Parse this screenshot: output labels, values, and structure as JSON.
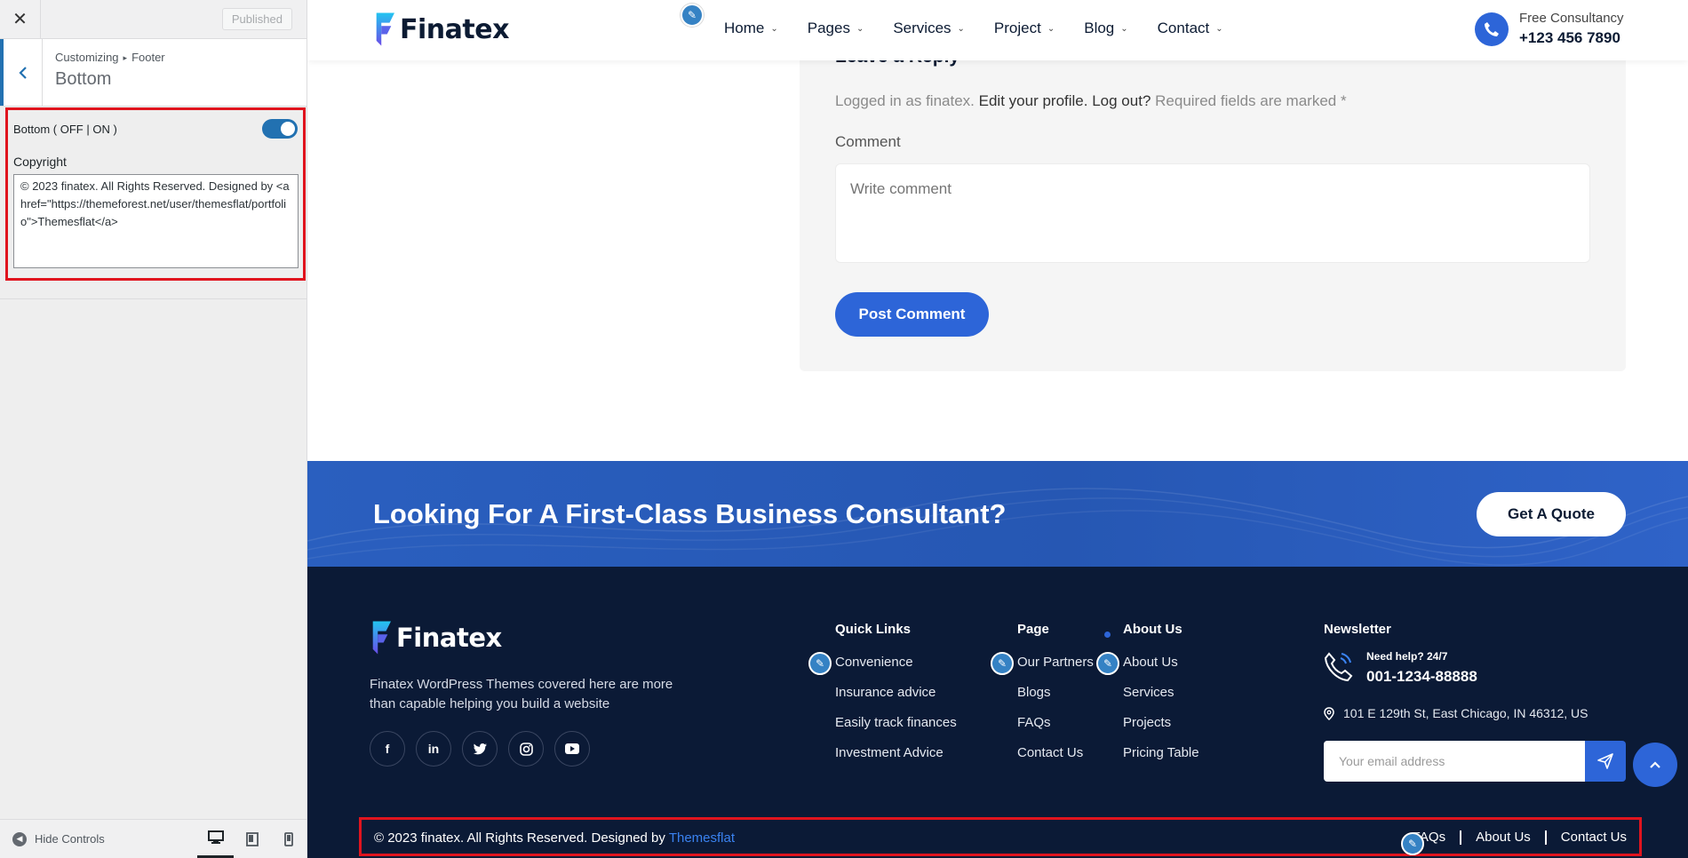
{
  "customizer": {
    "close_glyph": "✕",
    "published_label": "Published",
    "breadcrumb_root": "Customizing",
    "breadcrumb_sep": "▸",
    "breadcrumb_parent": "Footer",
    "section_title": "Bottom",
    "toggle_label": "Bottom ( OFF | ON )",
    "toggle_on": true,
    "copyright_label": "Copyright",
    "copyright_value": "© 2023 finatex. All Rights Reserved. Designed by <a href=\"https://themeforest.net/user/themesflat/portfolio\">Themesflat</a>",
    "hide_controls": "Hide Controls",
    "devices": [
      "desktop",
      "tablet",
      "mobile"
    ],
    "active_device": "desktop"
  },
  "header": {
    "logo_text": "Finatex",
    "nav": [
      "Home",
      "Pages",
      "Services",
      "Project",
      "Blog",
      "Contact"
    ],
    "consult_label": "Free Consultancy",
    "consult_phone": "+123 456 7890"
  },
  "comment": {
    "title": "Leave a Reply",
    "logged_in_prefix": "Logged in as finatex.",
    "edit_profile": "Edit your profile.",
    "log_out": "Log out?",
    "required_note": "Required fields are marked *",
    "comment_label": "Comment",
    "comment_placeholder": "Write comment",
    "submit_label": "Post Comment"
  },
  "cta": {
    "title": "Looking For A First-Class Business Consultant?",
    "button_label": "Get A Quote"
  },
  "footer": {
    "logo_text": "Finatex",
    "description": "Finatex WordPress Themes covered here are more than capable helping you build a website",
    "socials": [
      "facebook",
      "linkedin",
      "twitter",
      "instagram",
      "youtube"
    ],
    "columns": [
      {
        "title": "Quick Links",
        "links": [
          "Convenience",
          "Insurance advice",
          "Easily track finances",
          "Investment Advice"
        ]
      },
      {
        "title": "Page",
        "links": [
          "Our Partners",
          "Blogs",
          "FAQs",
          "Contact Us"
        ]
      },
      {
        "title": "About Us",
        "links": [
          "About Us",
          "Services",
          "Projects",
          "Pricing Table"
        ]
      }
    ],
    "newsletter_title": "Newsletter",
    "help_label": "Need help? 24/7",
    "help_phone": "001-1234-88888",
    "address": "101 E 129th St, East Chicago, IN 46312, US",
    "email_placeholder": "Your email address",
    "copyright_text": "© 2023 finatex. All Rights Reserved. Designed by",
    "copyright_link": "Themesflat",
    "bottom_links": [
      "FAQs",
      "About Us",
      "Contact Us"
    ]
  },
  "colors": {
    "accent": "#2d65d8",
    "wp_blue": "#2271b1",
    "footer_bg": "#0b1a36",
    "highlight": "#e0141e"
  }
}
